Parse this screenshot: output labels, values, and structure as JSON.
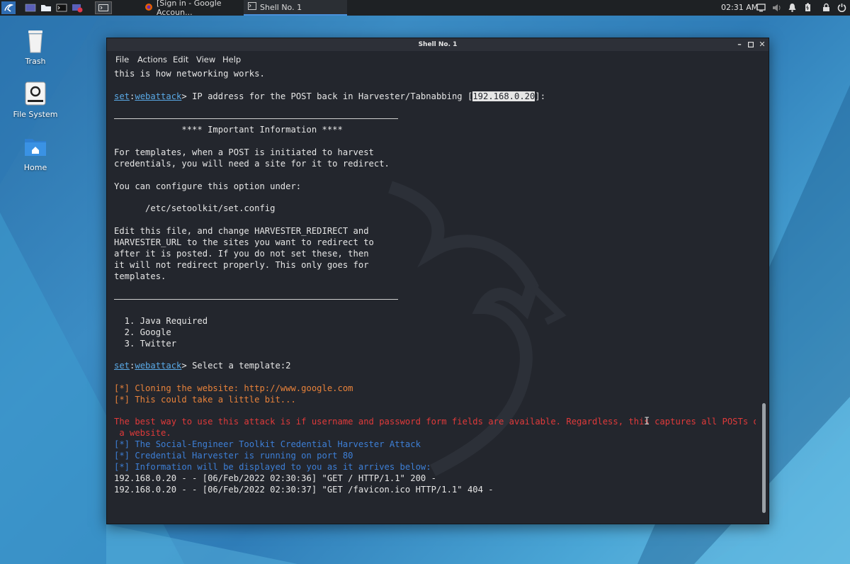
{
  "taskbar": {
    "tasks": [
      {
        "label": "[Sign in - Google Accoun...",
        "icon": "firefox-icon"
      },
      {
        "label": "Shell No. 1",
        "icon": "terminal-icon"
      }
    ],
    "clock": "02:31 AM"
  },
  "desktop": {
    "icons": [
      {
        "label": "Trash",
        "icon": "trash-icon"
      },
      {
        "label": "File System",
        "icon": "drive-icon"
      },
      {
        "label": "Home",
        "icon": "home-folder-icon"
      }
    ]
  },
  "window": {
    "title": "Shell No. 1",
    "menu": [
      "File",
      "Actions",
      "Edit",
      "View",
      "Help"
    ]
  },
  "terminal": {
    "prompt_set": "set",
    "prompt_module": "webattack",
    "lines": {
      "l0": "this is how networking works.",
      "ip_prompt_pre": "> IP address for the POST back in Harvester/Tabnabbing [",
      "ip_value": "192.168.0.20",
      "ip_prompt_post": "]:",
      "important": "             **** Important Information ****",
      "t1": "For templates, when a POST is initiated to harvest",
      "t2": "credentials, you will need a site for it to redirect.",
      "t3": "You can configure this option under:",
      "t4": "      /etc/setoolkit/set.config",
      "t5": "Edit this file, and change HARVESTER_REDIRECT and",
      "t6": "HARVESTER_URL to the sites you want to redirect to",
      "t7": "after it is posted. If you do not set these, then",
      "t8": "it will not redirect properly. This only goes for",
      "t9": "templates.",
      "o1": "  1. Java Required",
      "o2": "  2. Google",
      "o3": "  3. Twitter",
      "select_prompt": "> Select a template:2",
      "c1": "[*] Cloning the website: http://www.google.com",
      "c2": "[*] This could take a little bit...",
      "r1": "The best way to use this attack is if username and password form fields are available. Regardless, this captures all POSTs on",
      "r2": " a website.",
      "b1": "[*] The Social-Engineer Toolkit Credential Harvester Attack",
      "b2": "[*] Credential Harvester is running on port 80",
      "b3": "[*] Information will be displayed to you as it arrives below:",
      "g1": "192.168.0.20 - - [06/Feb/2022 02:30:36] \"GET / HTTP/1.1\" 200 -",
      "g2": "192.168.0.20 - - [06/Feb/2022 02:30:37] \"GET /favicon.ico HTTP/1.1\" 404 -"
    }
  }
}
